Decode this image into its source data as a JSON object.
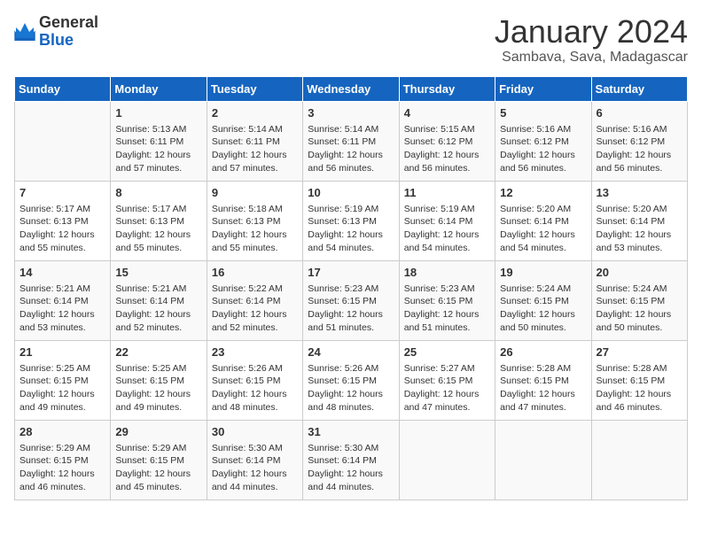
{
  "logo": {
    "general": "General",
    "blue": "Blue"
  },
  "title": "January 2024",
  "subtitle": "Sambava, Sava, Madagascar",
  "headers": [
    "Sunday",
    "Monday",
    "Tuesday",
    "Wednesday",
    "Thursday",
    "Friday",
    "Saturday"
  ],
  "weeks": [
    [
      {
        "day": "",
        "info": ""
      },
      {
        "day": "1",
        "info": "Sunrise: 5:13 AM\nSunset: 6:11 PM\nDaylight: 12 hours\nand 57 minutes."
      },
      {
        "day": "2",
        "info": "Sunrise: 5:14 AM\nSunset: 6:11 PM\nDaylight: 12 hours\nand 57 minutes."
      },
      {
        "day": "3",
        "info": "Sunrise: 5:14 AM\nSunset: 6:11 PM\nDaylight: 12 hours\nand 56 minutes."
      },
      {
        "day": "4",
        "info": "Sunrise: 5:15 AM\nSunset: 6:12 PM\nDaylight: 12 hours\nand 56 minutes."
      },
      {
        "day": "5",
        "info": "Sunrise: 5:16 AM\nSunset: 6:12 PM\nDaylight: 12 hours\nand 56 minutes."
      },
      {
        "day": "6",
        "info": "Sunrise: 5:16 AM\nSunset: 6:12 PM\nDaylight: 12 hours\nand 56 minutes."
      }
    ],
    [
      {
        "day": "7",
        "info": "Sunrise: 5:17 AM\nSunset: 6:13 PM\nDaylight: 12 hours\nand 55 minutes."
      },
      {
        "day": "8",
        "info": "Sunrise: 5:17 AM\nSunset: 6:13 PM\nDaylight: 12 hours\nand 55 minutes."
      },
      {
        "day": "9",
        "info": "Sunrise: 5:18 AM\nSunset: 6:13 PM\nDaylight: 12 hours\nand 55 minutes."
      },
      {
        "day": "10",
        "info": "Sunrise: 5:19 AM\nSunset: 6:13 PM\nDaylight: 12 hours\nand 54 minutes."
      },
      {
        "day": "11",
        "info": "Sunrise: 5:19 AM\nSunset: 6:14 PM\nDaylight: 12 hours\nand 54 minutes."
      },
      {
        "day": "12",
        "info": "Sunrise: 5:20 AM\nSunset: 6:14 PM\nDaylight: 12 hours\nand 54 minutes."
      },
      {
        "day": "13",
        "info": "Sunrise: 5:20 AM\nSunset: 6:14 PM\nDaylight: 12 hours\nand 53 minutes."
      }
    ],
    [
      {
        "day": "14",
        "info": "Sunrise: 5:21 AM\nSunset: 6:14 PM\nDaylight: 12 hours\nand 53 minutes."
      },
      {
        "day": "15",
        "info": "Sunrise: 5:21 AM\nSunset: 6:14 PM\nDaylight: 12 hours\nand 52 minutes."
      },
      {
        "day": "16",
        "info": "Sunrise: 5:22 AM\nSunset: 6:14 PM\nDaylight: 12 hours\nand 52 minutes."
      },
      {
        "day": "17",
        "info": "Sunrise: 5:23 AM\nSunset: 6:15 PM\nDaylight: 12 hours\nand 51 minutes."
      },
      {
        "day": "18",
        "info": "Sunrise: 5:23 AM\nSunset: 6:15 PM\nDaylight: 12 hours\nand 51 minutes."
      },
      {
        "day": "19",
        "info": "Sunrise: 5:24 AM\nSunset: 6:15 PM\nDaylight: 12 hours\nand 50 minutes."
      },
      {
        "day": "20",
        "info": "Sunrise: 5:24 AM\nSunset: 6:15 PM\nDaylight: 12 hours\nand 50 minutes."
      }
    ],
    [
      {
        "day": "21",
        "info": "Sunrise: 5:25 AM\nSunset: 6:15 PM\nDaylight: 12 hours\nand 49 minutes."
      },
      {
        "day": "22",
        "info": "Sunrise: 5:25 AM\nSunset: 6:15 PM\nDaylight: 12 hours\nand 49 minutes."
      },
      {
        "day": "23",
        "info": "Sunrise: 5:26 AM\nSunset: 6:15 PM\nDaylight: 12 hours\nand 48 minutes."
      },
      {
        "day": "24",
        "info": "Sunrise: 5:26 AM\nSunset: 6:15 PM\nDaylight: 12 hours\nand 48 minutes."
      },
      {
        "day": "25",
        "info": "Sunrise: 5:27 AM\nSunset: 6:15 PM\nDaylight: 12 hours\nand 47 minutes."
      },
      {
        "day": "26",
        "info": "Sunrise: 5:28 AM\nSunset: 6:15 PM\nDaylight: 12 hours\nand 47 minutes."
      },
      {
        "day": "27",
        "info": "Sunrise: 5:28 AM\nSunset: 6:15 PM\nDaylight: 12 hours\nand 46 minutes."
      }
    ],
    [
      {
        "day": "28",
        "info": "Sunrise: 5:29 AM\nSunset: 6:15 PM\nDaylight: 12 hours\nand 46 minutes."
      },
      {
        "day": "29",
        "info": "Sunrise: 5:29 AM\nSunset: 6:15 PM\nDaylight: 12 hours\nand 45 minutes."
      },
      {
        "day": "30",
        "info": "Sunrise: 5:30 AM\nSunset: 6:14 PM\nDaylight: 12 hours\nand 44 minutes."
      },
      {
        "day": "31",
        "info": "Sunrise: 5:30 AM\nSunset: 6:14 PM\nDaylight: 12 hours\nand 44 minutes."
      },
      {
        "day": "",
        "info": ""
      },
      {
        "day": "",
        "info": ""
      },
      {
        "day": "",
        "info": ""
      }
    ]
  ]
}
